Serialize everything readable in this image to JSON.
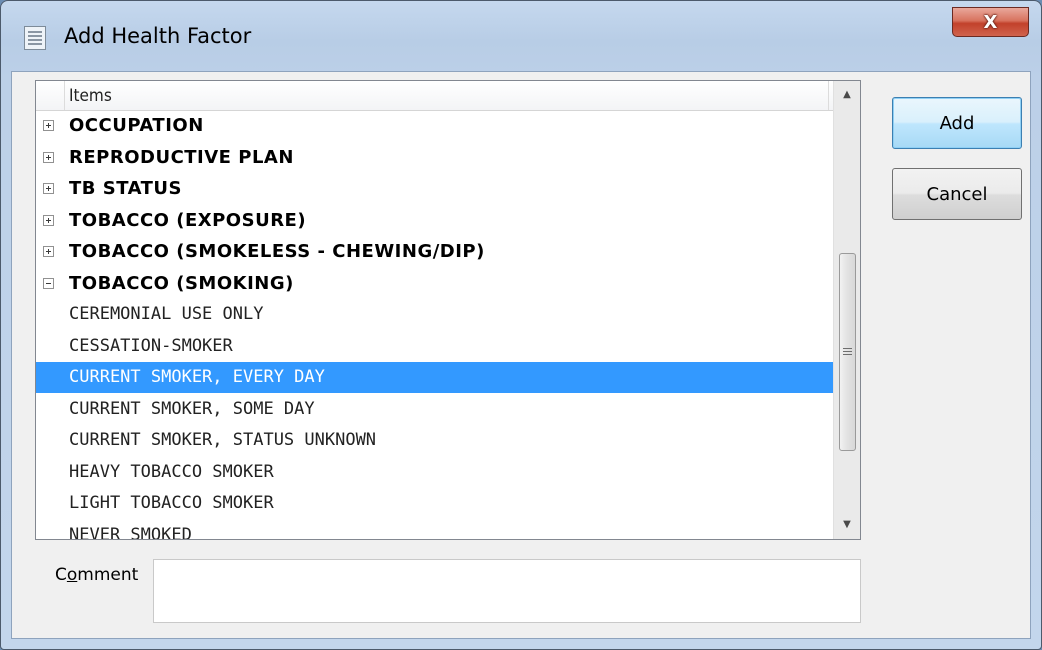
{
  "window": {
    "title": "Add Health Factor",
    "close_glyph": "X"
  },
  "tree": {
    "column_header": "Items",
    "rows": [
      {
        "label": "OCCUPATION",
        "kind": "group",
        "expander": "plus"
      },
      {
        "label": "REPRODUCTIVE PLAN",
        "kind": "group",
        "expander": "plus"
      },
      {
        "label": "TB STATUS",
        "kind": "group",
        "expander": "plus"
      },
      {
        "label": "TOBACCO (EXPOSURE)",
        "kind": "group",
        "expander": "plus"
      },
      {
        "label": "TOBACCO (SMOKELESS - CHEWING/DIP)",
        "kind": "group",
        "expander": "plus"
      },
      {
        "label": "TOBACCO (SMOKING)",
        "kind": "group",
        "expander": "minus"
      },
      {
        "label": "CEREMONIAL USE ONLY",
        "kind": "item"
      },
      {
        "label": "CESSATION-SMOKER",
        "kind": "item"
      },
      {
        "label": "CURRENT SMOKER, EVERY DAY",
        "kind": "item",
        "selected": true
      },
      {
        "label": "CURRENT SMOKER, SOME DAY",
        "kind": "item"
      },
      {
        "label": "CURRENT SMOKER, STATUS UNKNOWN",
        "kind": "item"
      },
      {
        "label": "HEAVY TOBACCO SMOKER",
        "kind": "item"
      },
      {
        "label": "LIGHT TOBACCO SMOKER",
        "kind": "item"
      },
      {
        "label": "NEVER SMOKED",
        "kind": "item"
      }
    ],
    "scroll_up_glyph": "▲",
    "scroll_down_glyph": "▼"
  },
  "buttons": {
    "add_label": "Add",
    "cancel_label": "Cancel"
  },
  "comment": {
    "label_prefix": "C",
    "label_accel": "o",
    "label_suffix": "mment",
    "value": ""
  },
  "colors": {
    "selection": "#3399ff",
    "close_button": "#c2412b",
    "default_button_border": "#3c7fb1"
  }
}
